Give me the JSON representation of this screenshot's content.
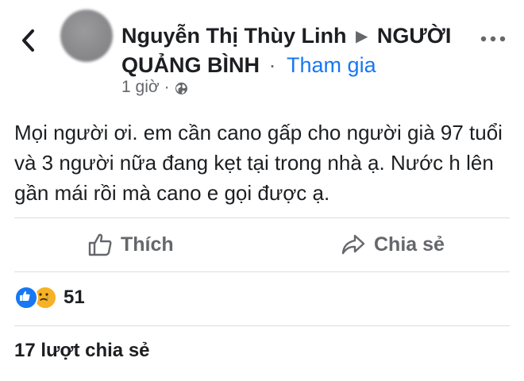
{
  "header": {
    "author_name": "Nguyễn Thị Thùy Linh",
    "arrow": "▶",
    "group_name": "NGƯỜI QUẢNG BÌNH",
    "separator": "·",
    "join_label": "Tham gia",
    "timestamp": "1 giờ",
    "meta_separator": "·",
    "privacy_icon": "globe-icon",
    "back_icon": "chevron-left-icon",
    "more_icon": "more-horizontal-icon"
  },
  "post": {
    "text": "Mọi người ơi. em cần cano gấp cho người già 97 tuổi và 3 người nữa đang kẹt tại trong nhà ạ. Nước h lên gần mái rồi mà cano e gọi được ạ."
  },
  "actions": {
    "like_label": "Thích",
    "like_icon": "thumbs-up-icon",
    "share_label": "Chia sẻ",
    "share_icon": "share-arrow-icon"
  },
  "reactions": {
    "icons": [
      "like-reaction-icon",
      "sad-reaction-icon"
    ],
    "count": "51"
  },
  "shares": {
    "label": "17 lượt chia sẻ"
  },
  "colors": {
    "link_blue": "#1877f2",
    "secondary_text": "#65676b",
    "primary_text": "#1c1e21",
    "divider": "#dadde1",
    "sad_yellow": "#f7b125"
  }
}
